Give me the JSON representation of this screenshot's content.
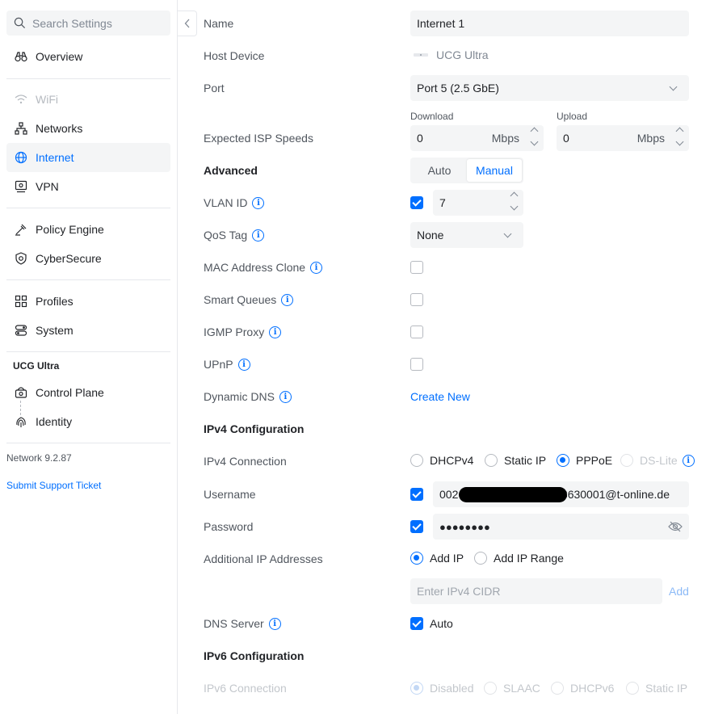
{
  "sidebar": {
    "search_placeholder": "Search Settings",
    "items": [
      {
        "label": "Overview",
        "icon": "binoculars-icon"
      },
      {
        "label": "WiFi",
        "icon": "wifi-icon"
      },
      {
        "label": "Networks",
        "icon": "networks-icon"
      },
      {
        "label": "Internet",
        "icon": "globe-icon"
      },
      {
        "label": "VPN",
        "icon": "vpn-icon"
      },
      {
        "label": "Policy Engine",
        "icon": "policy-icon"
      },
      {
        "label": "CyberSecure",
        "icon": "shield-icon"
      },
      {
        "label": "Profiles",
        "icon": "profiles-icon"
      },
      {
        "label": "System",
        "icon": "system-icon"
      }
    ],
    "device_section": "UCG Ultra",
    "device_items": [
      {
        "label": "Control Plane",
        "icon": "control-plane-icon"
      },
      {
        "label": "Identity",
        "icon": "fingerprint-icon"
      }
    ],
    "version": "Network 9.2.87",
    "support_link": "Submit Support Ticket"
  },
  "form": {
    "name_label": "Name",
    "name_value": "Internet 1",
    "host_label": "Host Device",
    "host_value": "UCG Ultra",
    "port_label": "Port",
    "port_value": "Port 5 (2.5 GbE)",
    "speeds_label": "Expected ISP Speeds",
    "download_label": "Download",
    "download_value": "0",
    "upload_label": "Upload",
    "upload_value": "0",
    "unit": "Mbps",
    "advanced_label": "Advanced",
    "advanced_options": [
      "Auto",
      "Manual"
    ],
    "advanced_selected": "Manual",
    "vlan_label": "VLAN ID",
    "vlan_value": "7",
    "qos_label": "QoS Tag",
    "qos_value": "None",
    "mac_label": "MAC Address Clone",
    "smartq_label": "Smart Queues",
    "igmp_label": "IGMP Proxy",
    "upnp_label": "UPnP",
    "ddns_label": "Dynamic DNS",
    "ddns_action": "Create New",
    "ipv4_header": "IPv4 Configuration",
    "ipv4_conn_label": "IPv4 Connection",
    "ipv4_options": [
      "DHCPv4",
      "Static IP",
      "PPPoE",
      "DS-Lite"
    ],
    "ipv4_selected": "PPPoE",
    "username_label": "Username",
    "username_prefix": "002",
    "username_suffix": "8630001@t-online.de",
    "password_label": "Password",
    "password_value": "●●●●●●●●",
    "addl_ip_label": "Additional IP Addresses",
    "addl_ip_options": [
      "Add IP",
      "Add IP Range"
    ],
    "addl_ip_selected": "Add IP",
    "cidr_placeholder": "Enter IPv4 CIDR",
    "add_button": "Add",
    "dns_label": "DNS Server",
    "dns_auto": "Auto",
    "ipv6_header": "IPv6 Configuration",
    "ipv6_conn_label": "IPv6 Connection",
    "ipv6_options": [
      "Disabled",
      "SLAAC",
      "DHCPv6",
      "Static IP"
    ],
    "ipv6_selected": "Disabled"
  },
  "colors": {
    "accent": "#006fff",
    "text": "#212327",
    "muted": "#50565e",
    "field_bg": "#f4f5f6"
  }
}
